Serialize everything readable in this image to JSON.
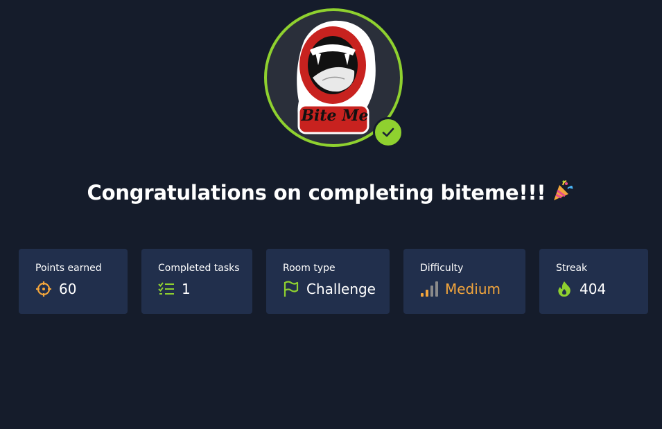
{
  "badge": {
    "image_text": "Bite Me",
    "ring_color": "#8fd12f",
    "completed_icon": "check-icon"
  },
  "header": {
    "title": "Congratulations on completing biteme!!!",
    "emoji": "party-popper-icon"
  },
  "stats": [
    {
      "label": "Points earned",
      "value": "60",
      "icon": "target-icon"
    },
    {
      "label": "Completed tasks",
      "value": "1",
      "icon": "checklist-icon"
    },
    {
      "label": "Room type",
      "value": "Challenge",
      "icon": "flag-icon"
    },
    {
      "label": "Difficulty",
      "value": "Medium",
      "icon": "signal-bars-icon",
      "value_color": "#f2a53c"
    },
    {
      "label": "Streak",
      "value": "404",
      "icon": "flame-icon"
    }
  ],
  "colors": {
    "background": "#151c2b",
    "card": "#212f4c",
    "accent_green": "#8fd12f",
    "accent_orange": "#f2a53c"
  }
}
